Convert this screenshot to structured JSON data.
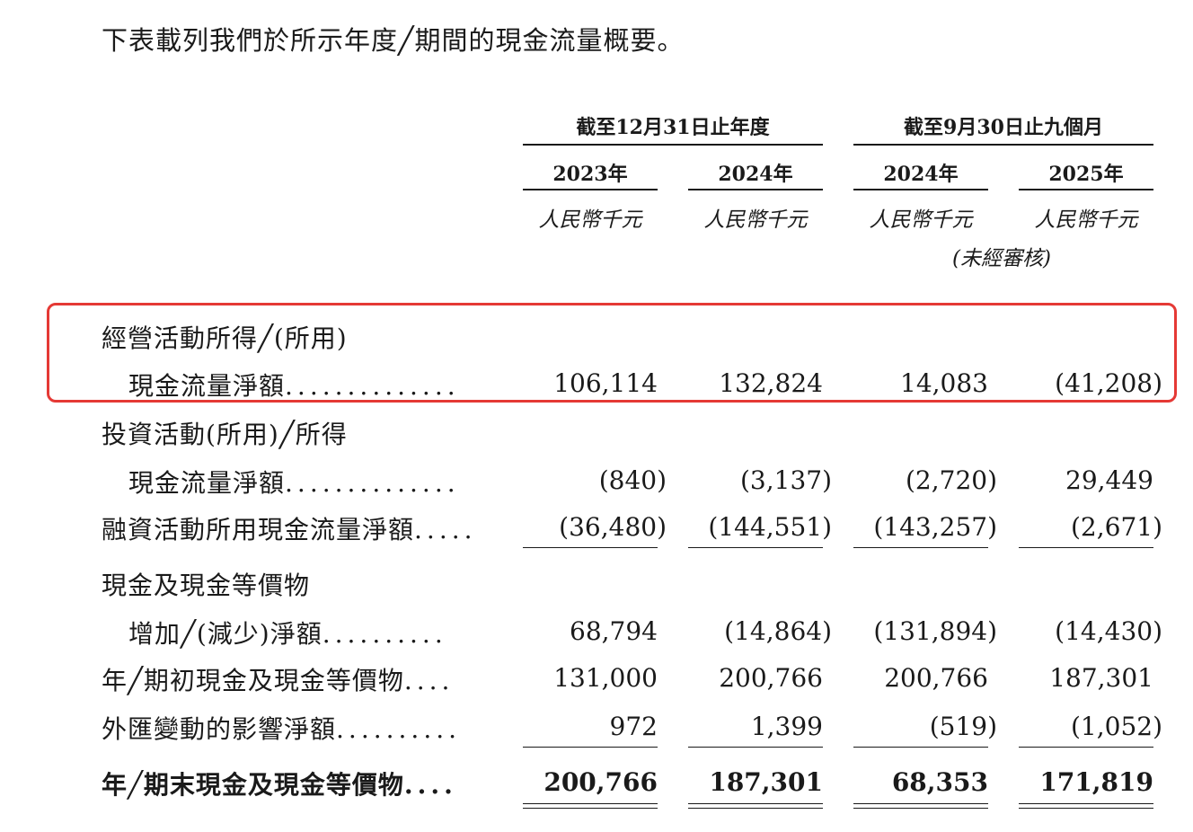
{
  "intro": "下表載列我們於所示年度╱期間的現金流量概要。",
  "headers": {
    "group1": "截至12月31日止年度",
    "group2": "截至9月30日止九個月",
    "years": [
      "2023年",
      "2024年",
      "2024年",
      "2025年"
    ],
    "unit": "人民幣千元",
    "unaudited": "(未經審核)"
  },
  "rows": {
    "operating": {
      "label1": "經營活動所得╱(所用)",
      "label2": "現金流量淨額",
      "leader": "..............",
      "values": [
        "106,114",
        "132,824",
        "14,083",
        "(41,208)"
      ]
    },
    "investing": {
      "label1": "投資活動(所用)╱所得",
      "label2": "現金流量淨額",
      "leader": "..............",
      "values": [
        "(840)",
        "(3,137)",
        "(2,720)",
        "29,449"
      ]
    },
    "financing": {
      "label": "融資活動所用現金流量淨額",
      "leader": ".....",
      "values": [
        "(36,480)",
        "(144,551)",
        "(143,257)",
        "(2,671)"
      ]
    },
    "net_change": {
      "label1": "現金及現金等價物",
      "label2": "增加╱(減少)淨額",
      "leader": "..........",
      "values": [
        "68,794",
        "(14,864)",
        "(131,894)",
        "(14,430)"
      ]
    },
    "opening": {
      "label": "年╱期初現金及現金等價物",
      "leader": "....",
      "values": [
        "131,000",
        "200,766",
        "200,766",
        "187,301"
      ]
    },
    "fx": {
      "label": "外匯變動的影響淨額",
      "leader": "..........",
      "values": [
        "972",
        "1,399",
        "(519)",
        "(1,052)"
      ]
    },
    "closing": {
      "label": "年╱期末現金及現金等價物",
      "leader": "....",
      "values": [
        "200,766",
        "187,301",
        "68,353",
        "171,819"
      ]
    }
  },
  "colors": {
    "highlight": "#e53935",
    "text": "#1a1a1a"
  }
}
